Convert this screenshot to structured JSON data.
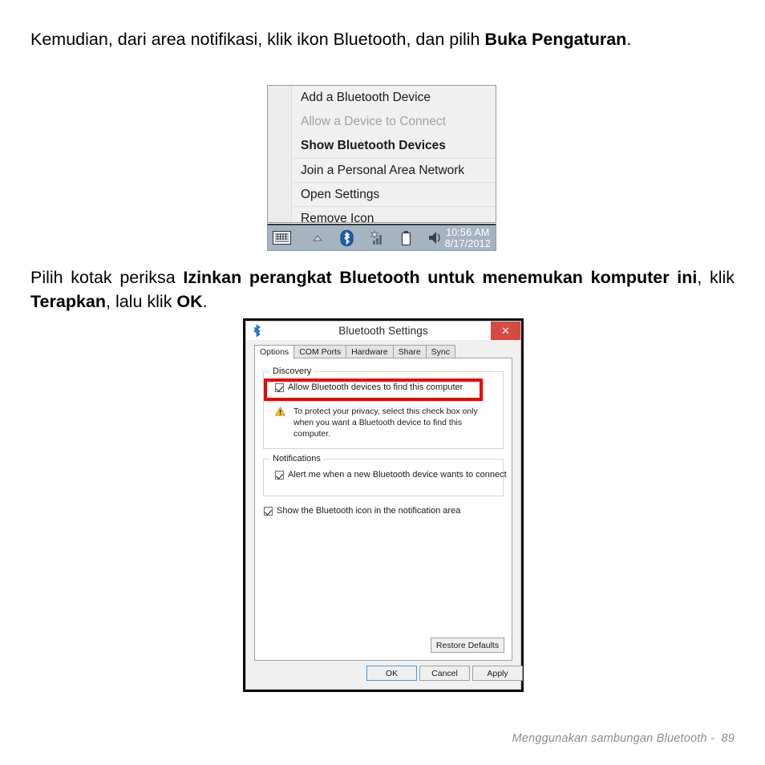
{
  "page": {
    "paragraph1": {
      "pre": "Kemudian, dari area notifikasi, klik ikon Bluetooth, dan pilih ",
      "bold": "Buka Pengaturan",
      "post": "."
    },
    "paragraph2": {
      "pre": "Pilih kotak periksa ",
      "bold1": "Izinkan perangkat Bluetooth untuk menemukan komputer ini",
      "mid1": ", klik ",
      "bold2": "Terapkan",
      "mid2": ", lalu klik ",
      "bold3": "OK",
      "post": "."
    },
    "footer": "Menggunakan sambungan Bluetooth -  89"
  },
  "context_menu": {
    "items": [
      {
        "label": "Add a Bluetooth Device",
        "state": "normal",
        "separator": false
      },
      {
        "label": "Allow a Device to Connect",
        "state": "disabled",
        "separator": false
      },
      {
        "label": "Show Bluetooth Devices",
        "state": "bold",
        "separator": false
      },
      {
        "label": "Join a Personal Area Network",
        "state": "normal",
        "separator": true
      },
      {
        "label": "Open Settings",
        "state": "normal",
        "separator": true
      },
      {
        "label": "Remove Icon",
        "state": "normal",
        "separator": true
      }
    ]
  },
  "taskbar": {
    "icons": [
      "keyboard-icon",
      "show-hidden-icons-chevron",
      "bluetooth-icon",
      "wireless-signal-icon",
      "battery-icon",
      "volume-icon"
    ],
    "clock_time": "10:56 AM",
    "clock_date": "8/17/2012",
    "background_color": "#a6b3c0",
    "bluetooth_color": "#1a5fb4"
  },
  "dialog": {
    "title": "Bluetooth Settings",
    "close_label": "✕",
    "close_color": "#d64a42",
    "tabs": [
      {
        "label": "Options",
        "active": true
      },
      {
        "label": "COM Ports",
        "active": false
      },
      {
        "label": "Hardware",
        "active": false
      },
      {
        "label": "Share",
        "active": false
      },
      {
        "label": "Sync",
        "active": false
      }
    ],
    "discovery": {
      "group_label": "Discovery",
      "checkbox_label": "Allow Bluetooth devices to find this computer",
      "checked": true,
      "warning_text": "To protect your privacy, select this check box only when you want a Bluetooth device to find this computer."
    },
    "notifications": {
      "group_label": "Notifications",
      "checkbox_label": "Alert me when a new Bluetooth device wants to connect",
      "checked": true
    },
    "show_icon": {
      "checkbox_label": "Show the Bluetooth icon in the notification area",
      "checked": true
    },
    "buttons": {
      "restore_defaults": "Restore Defaults",
      "ok": "OK",
      "cancel": "Cancel",
      "apply": "Apply"
    },
    "highlight_color": "#ee0000"
  }
}
